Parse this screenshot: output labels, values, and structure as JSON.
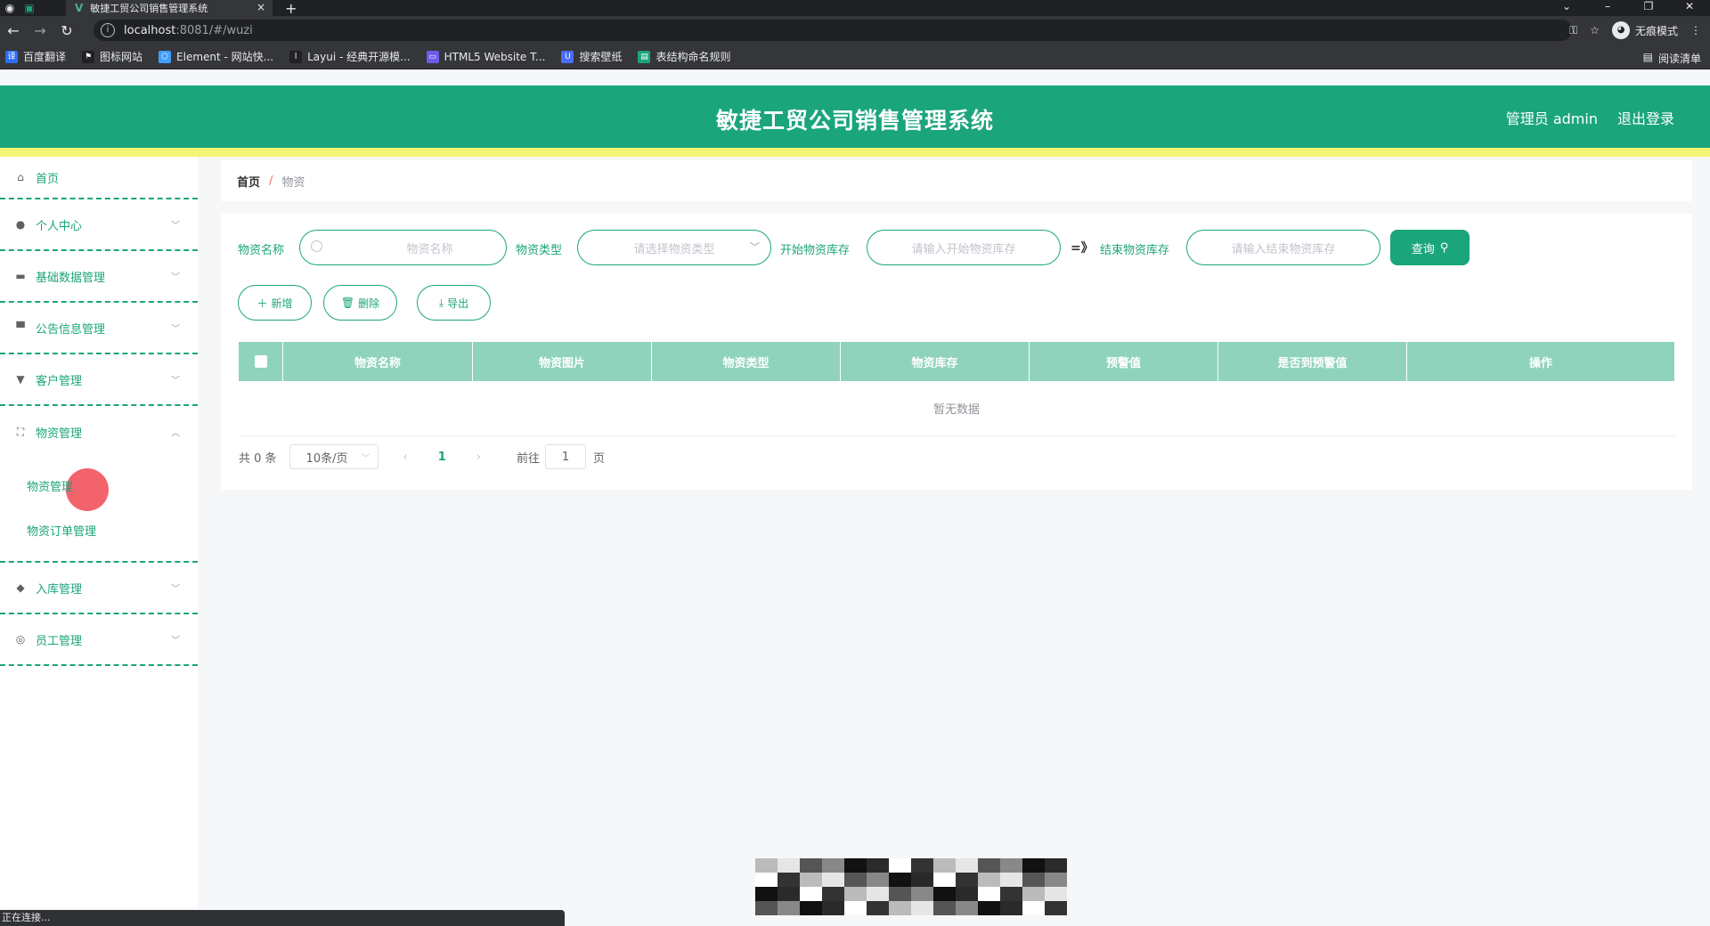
{
  "browser": {
    "tab_title": "敏捷工贸公司销售管理系统",
    "tab_close": "×",
    "new_tab": "+",
    "url_host": "localhost",
    "url_path": ":8081/#/wuzi",
    "incognito_label": "无痕模式",
    "reading_list": "阅读清单",
    "status_text": "正在连接...",
    "bookmarks": [
      {
        "label": "百度翻译",
        "color": "#2f6df6"
      },
      {
        "label": "图标网站",
        "color": "#202124"
      },
      {
        "label": "Element - 网站快...",
        "color": "#409eff"
      },
      {
        "label": "Layui - 经典开源模...",
        "color": "#202124"
      },
      {
        "label": "HTML5 Website T...",
        "color": "#6d5ce8"
      },
      {
        "label": "搜索壁纸",
        "color": "#4a6cf7"
      },
      {
        "label": "表结构命名规则",
        "color": "#1ba57b"
      }
    ]
  },
  "header": {
    "title": "敏捷工贸公司销售管理系统",
    "user": "管理员 admin",
    "logout": "退出登录",
    "brand_color": "#1ba57b"
  },
  "sidebar": {
    "items": [
      {
        "label": "首页",
        "icon": "home-icon"
      },
      {
        "label": "个人中心",
        "icon": "user-icon"
      },
      {
        "label": "基础数据管理",
        "icon": "folder-icon"
      },
      {
        "label": "公告信息管理",
        "icon": "monitor-icon"
      },
      {
        "label": "客户管理",
        "icon": "chair-icon"
      },
      {
        "label": "物资管理",
        "icon": "fullscreen-icon"
      },
      {
        "label": "入库管理",
        "icon": "location-icon"
      },
      {
        "label": "员工管理",
        "icon": "globe-icon"
      }
    ],
    "sub_items": [
      {
        "label": "物资管理"
      },
      {
        "label": "物资订单管理"
      }
    ]
  },
  "breadcrumb": {
    "home": "首页",
    "separator": "/",
    "current": "物资"
  },
  "search": {
    "name_label": "物资名称",
    "name_placeholder": "物资名称",
    "type_label": "物资类型",
    "type_placeholder": "请选择物资类型",
    "start_label": "开始物资库存",
    "start_placeholder": "请输入开始物资库存",
    "range_symbol": "=》",
    "end_label": "结束物资库存",
    "end_placeholder": "请输入结束物资库存",
    "query_button": "查询"
  },
  "actions": {
    "add": "新增",
    "delete": "删除",
    "export": "导出"
  },
  "table": {
    "columns": [
      "物资名称",
      "物资图片",
      "物资类型",
      "物资库存",
      "预警值",
      "是否到预警值",
      "操作"
    ],
    "empty_text": "暂无数据"
  },
  "pagination": {
    "total": "共 0 条",
    "page_size": "10条/页",
    "current_page": "1",
    "goto_label": "前往",
    "goto_value": "1",
    "page_unit": "页"
  }
}
